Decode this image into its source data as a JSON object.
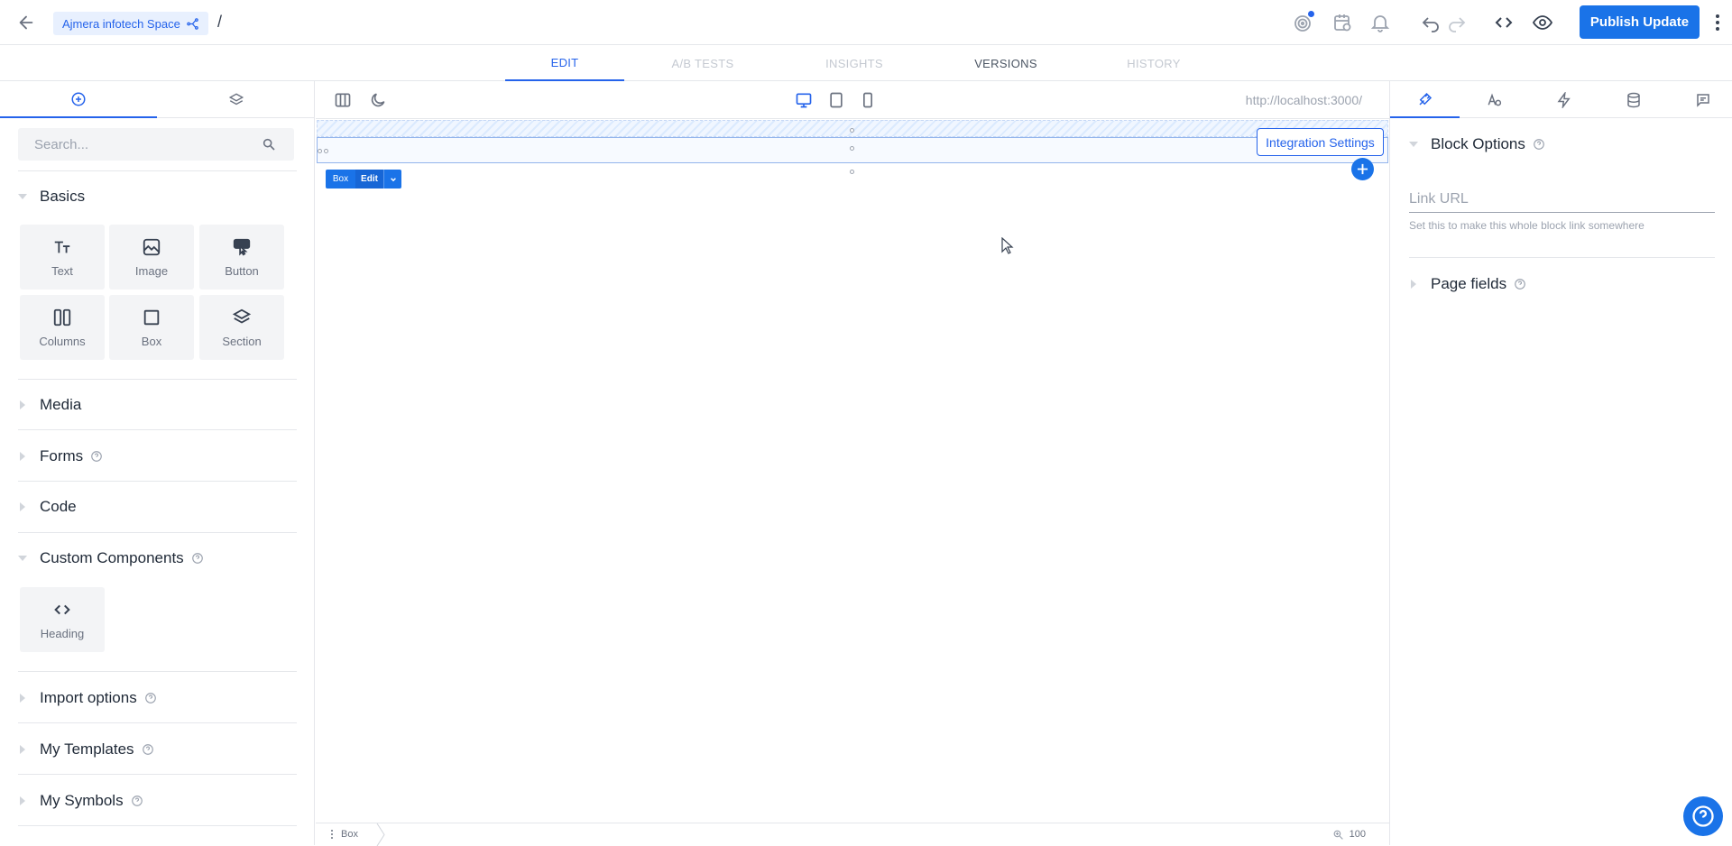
{
  "header": {
    "space_name": "Ajmera infotech Space",
    "path_separator": "/",
    "publish_label": "Publish Update",
    "icons": [
      "back-arrow-icon",
      "branch-icon",
      "target-icon",
      "calendar-icon",
      "bell-icon",
      "undo-icon",
      "redo-icon",
      "code-icon",
      "eye-icon",
      "more-vertical-icon"
    ],
    "accent_color": "#1a73e8"
  },
  "mode_tabs": [
    {
      "label": "EDIT",
      "state": "active"
    },
    {
      "label": "A/B TESTS",
      "state": "disabled"
    },
    {
      "label": "INSIGHTS",
      "state": "disabled"
    },
    {
      "label": "VERSIONS",
      "state": "enabled"
    },
    {
      "label": "HISTORY",
      "state": "disabled"
    }
  ],
  "left_panel": {
    "tabs": [
      {
        "icon": "plus-circle-icon",
        "active": true
      },
      {
        "icon": "layers-icon",
        "active": false
      }
    ],
    "search": {
      "placeholder": "Search...",
      "value": ""
    },
    "sections": {
      "basics": "Basics",
      "media": "Media",
      "forms": "Forms",
      "code": "Code",
      "custom_components": "Custom Components",
      "import_options": "Import options",
      "my_templates": "My Templates",
      "my_symbols": "My Symbols"
    },
    "basics_items": [
      "Text",
      "Image",
      "Button",
      "Columns",
      "Box",
      "Section"
    ],
    "custom_items": [
      "Heading"
    ]
  },
  "canvas": {
    "url": "http://localhost:3000/",
    "integration_label": "Integration Settings",
    "pill": {
      "type": "Box",
      "edit": "Edit"
    },
    "breadcrumb": "Box",
    "zoom": "100"
  },
  "right_panel": {
    "tabs": [
      "style-icon",
      "typography-icon",
      "bolt-icon",
      "database-icon",
      "comment-icon"
    ],
    "block_options_title": "Block Options",
    "link_url_placeholder": "Link URL",
    "link_help": "Set this to make this whole block link somewhere",
    "page_fields_title": "Page fields"
  }
}
